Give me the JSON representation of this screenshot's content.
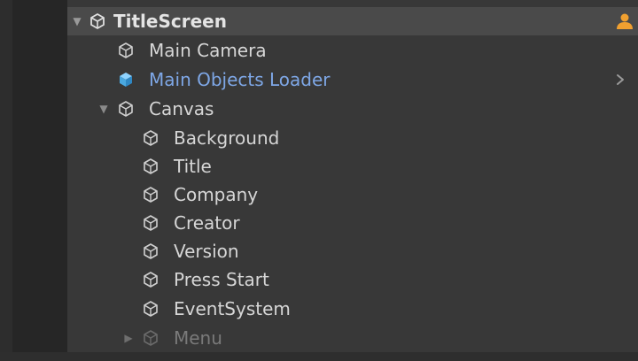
{
  "hierarchy": {
    "scene": {
      "name": "TitleScreen",
      "collaborators_count": "1",
      "icons": {
        "expand": "triangle-down-icon",
        "scene": "unity-scene-icon",
        "user": "user-icon",
        "menu": "kebab-menu-icon"
      }
    },
    "items": [
      {
        "label": "Main Camera",
        "icon": "gameobject-cube-icon"
      },
      {
        "label": "Main Objects Loader",
        "icon": "prefab-cube-icon",
        "style": "prefab",
        "trailing_icon": "chevron-right-icon"
      },
      {
        "label": "Canvas",
        "icon": "gameobject-cube-icon",
        "expanded": true
      },
      {
        "label": "Background",
        "icon": "gameobject-cube-icon"
      },
      {
        "label": "Title",
        "icon": "gameobject-cube-icon"
      },
      {
        "label": "Company",
        "icon": "gameobject-cube-icon"
      },
      {
        "label": "Creator",
        "icon": "gameobject-cube-icon"
      },
      {
        "label": "Version",
        "icon": "gameobject-cube-icon"
      },
      {
        "label": "Press Start",
        "icon": "gameobject-cube-icon"
      },
      {
        "label": "EventSystem",
        "icon": "gameobject-cube-icon"
      },
      {
        "label": "Menu",
        "icon": "gameobject-cube-icon",
        "style": "disabled",
        "expanded": false
      }
    ]
  },
  "colors": {
    "panel_bg": "#383838",
    "scene_row_bg": "#4a4a4a",
    "text": "#d6d6d6",
    "prefab_text": "#7ea7e6",
    "prefab_icon": "#5fb3ea",
    "disabled_text": "#7a7a7a",
    "collaborator_orange": "#f0a030"
  }
}
